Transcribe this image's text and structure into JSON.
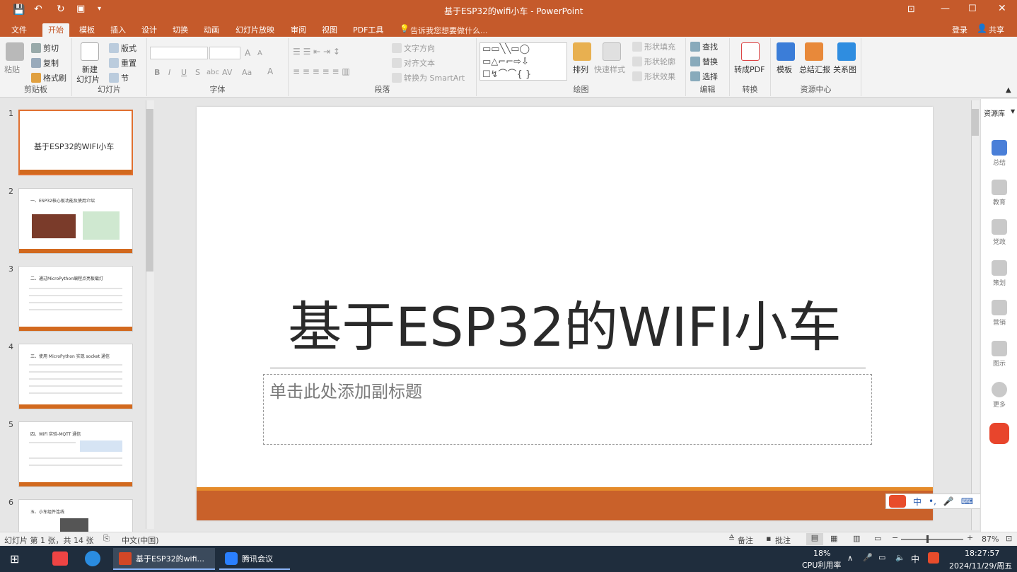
{
  "window": {
    "title": "基于ESP32的wifi小车 - PowerPoint",
    "login": "登录",
    "share": "共享"
  },
  "tabs": [
    "文件",
    "开始",
    "模板",
    "插入",
    "设计",
    "切换",
    "动画",
    "幻灯片放映",
    "审阅",
    "视图",
    "PDF工具"
  ],
  "tell_me": "告诉我您想要做什么...",
  "ribbon": {
    "clipboard": {
      "paste": "粘贴",
      "cut": "剪切",
      "copy": "复制",
      "format_painter": "格式刷",
      "label": "剪贴板"
    },
    "slides": {
      "new_slide": "新建",
      "new_slide2": "幻灯片",
      "layout": "版式",
      "reset": "重置",
      "section": "节",
      "label": "幻灯片"
    },
    "font": {
      "label": "字体",
      "grow": "A",
      "shrink": "A",
      "bold": "B",
      "italic": "I",
      "underline": "U",
      "strike": "S",
      "shadow": "abc",
      "spacing": "AV",
      "case": "Aa",
      "color": "A"
    },
    "paragraph": {
      "text_direction": "文字方向",
      "align_text": "对齐文本",
      "smartart": "转换为 SmartArt",
      "label": "段落"
    },
    "drawing": {
      "arrange": "排列",
      "quick_styles": "快速样式",
      "shape_fill": "形状填充",
      "shape_outline": "形状轮廓",
      "shape_effects": "形状效果",
      "label": "绘图"
    },
    "editing": {
      "find": "查找",
      "replace": "替换",
      "select": "选择",
      "label": "编辑"
    },
    "convert": {
      "to_pdf": "转成PDF",
      "label": "转换"
    },
    "resources": {
      "template": "模板",
      "summary": "总结汇报",
      "relation": "关系图",
      "label": "资源中心"
    }
  },
  "thumbnails": [
    {
      "num": "1",
      "title": "基于ESP32的WIFI小车"
    },
    {
      "num": "2",
      "title": "一、ESP32核心板功能及使用介绍"
    },
    {
      "num": "3",
      "title": "二、通过MicroPython编程点亮板载灯"
    },
    {
      "num": "4",
      "title": "三、使用 MicroPython 实现 socket 通信"
    },
    {
      "num": "5",
      "title": "四、WiFi 实验-MQTT 通信"
    },
    {
      "num": "6",
      "title": "五、小车组件连线"
    }
  ],
  "slide": {
    "title": "基于ESP32的WIFI小车",
    "subtitle_placeholder": "单击此处添加副标题"
  },
  "sidebar": {
    "header": "资源库",
    "items": [
      "总结",
      "教育",
      "党政",
      "策划",
      "营销",
      "图示",
      "更多"
    ]
  },
  "status": {
    "slide_info": "幻灯片 第 1 张，共 14 张",
    "language": "中文(中国)",
    "notes": "备注",
    "comments": "批注",
    "zoom": "87%"
  },
  "taskbar": {
    "ppt_window": "基于ESP32的wifi...",
    "tencent": "腾讯会议",
    "cpu_percent": "18%",
    "cpu_label": "CPU利用率",
    "ime": "中",
    "time": "18:27:57",
    "date": "2024/11/29/周五"
  },
  "ime_bar": [
    "中",
    "•,",
    "⌨"
  ],
  "colors": {
    "accent": "#c55a2b",
    "slide_bar": "#d2691e",
    "taskbar": "#1f2d3d"
  }
}
